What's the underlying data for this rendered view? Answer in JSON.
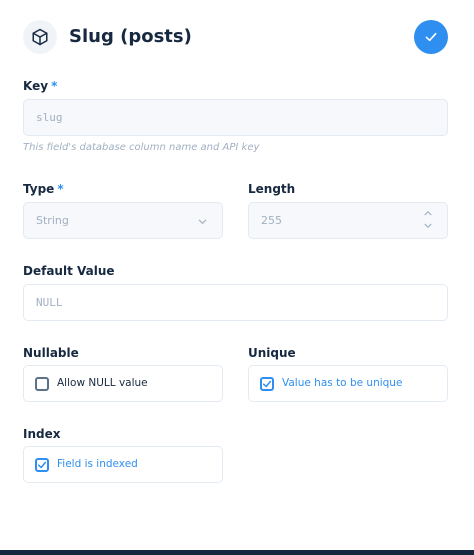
{
  "header": {
    "title": "Slug (posts)",
    "icon": "box-icon",
    "save_icon": "check-icon",
    "accent": "#2f8ff0"
  },
  "key": {
    "label": "Key",
    "required_mark": "*",
    "value": "slug",
    "hint": "This field's database column name and API key"
  },
  "type": {
    "label": "Type",
    "required_mark": "*",
    "value": "String"
  },
  "length": {
    "label": "Length",
    "value": "255"
  },
  "default_value": {
    "label": "Default Value",
    "placeholder": "NULL"
  },
  "nullable": {
    "label": "Nullable",
    "option": "Allow NULL value",
    "checked": false
  },
  "unique": {
    "label": "Unique",
    "option": "Value has to be unique",
    "checked": true
  },
  "index": {
    "label": "Index",
    "option": "Field is indexed",
    "checked": true
  }
}
